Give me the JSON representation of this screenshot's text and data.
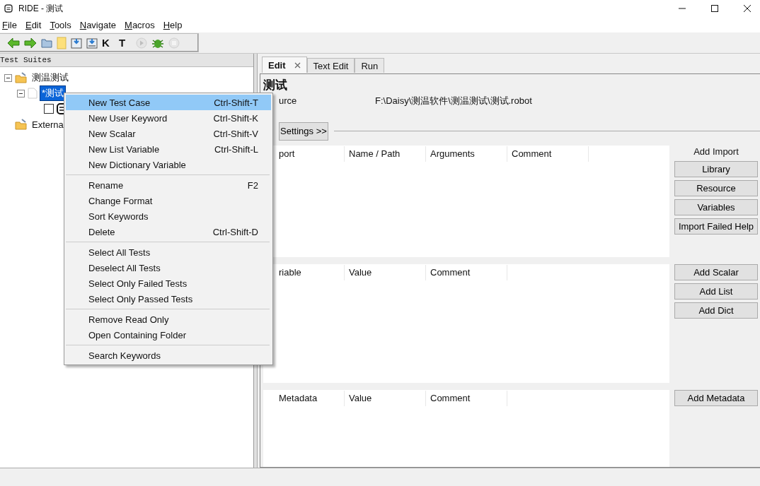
{
  "window": {
    "title": "RIDE - 测试"
  },
  "menubar": [
    "File",
    "Edit",
    "Tools",
    "Navigate",
    "Macros",
    "Help"
  ],
  "toolbar": [
    {
      "kind": "back",
      "disabled": false
    },
    {
      "kind": "forward",
      "disabled": false
    },
    {
      "kind": "open-suite",
      "disabled": false
    },
    {
      "kind": "open-dir",
      "disabled": false
    },
    {
      "kind": "save",
      "disabled": false
    },
    {
      "kind": "save-all",
      "disabled": false
    },
    {
      "kind": "search",
      "label": "K",
      "disabled": false
    },
    {
      "kind": "search",
      "label": "T",
      "disabled": false
    },
    {
      "kind": "run",
      "disabled": true
    },
    {
      "kind": "debug",
      "disabled": false
    },
    {
      "kind": "stop",
      "disabled": true
    }
  ],
  "tree": {
    "title": "Test Suites",
    "nodes": [
      {
        "label": "测温测试",
        "kind": "suite",
        "expanded": true,
        "selected": false,
        "children": [
          {
            "label": "*测试",
            "kind": "file",
            "expanded": true,
            "selected": true,
            "children": [
              {
                "kind": "test",
                "checked": false,
                "selected": false
              }
            ]
          }
        ]
      },
      {
        "label": "Externa",
        "kind": "suite",
        "selected": false
      }
    ]
  },
  "tabs": [
    {
      "label": "Edit",
      "selected": true,
      "closable": true
    },
    {
      "label": "Text Edit",
      "selected": false,
      "closable": false
    },
    {
      "label": "Run",
      "selected": false,
      "closable": false
    }
  ],
  "editor": {
    "title": "测试",
    "source_label": "urce",
    "source_value": "F:\\Daisy\\测温软件\\测温测试\\测试.robot",
    "settings_button": "Settings >>",
    "sections": [
      {
        "columns": [
          "port",
          "Name / Path",
          "Arguments",
          "Comment"
        ],
        "heading": "Add Import",
        "buttons": [
          "Library",
          "Resource",
          "Variables",
          "Import Failed Help"
        ]
      },
      {
        "columns": [
          "riable",
          "Value",
          "Comment"
        ],
        "buttons": [
          "Add Scalar",
          "Add List",
          "Add Dict"
        ]
      },
      {
        "columns": [
          "Metadata",
          "Value",
          "Comment"
        ],
        "buttons": [
          "Add Metadata"
        ]
      }
    ]
  },
  "context_menu": [
    [
      {
        "label": "New Test Case",
        "shortcut": "Ctrl-Shift-T",
        "selected": true
      },
      {
        "label": "New User Keyword",
        "shortcut": "Ctrl-Shift-K",
        "selected": false
      },
      {
        "label": "New Scalar",
        "shortcut": "Ctrl-Shift-V",
        "selected": false
      },
      {
        "label": "New List Variable",
        "shortcut": "Ctrl-Shift-L",
        "selected": false
      },
      {
        "label": "New Dictionary Variable",
        "selected": false
      }
    ],
    [
      {
        "label": "Rename",
        "shortcut": "F2",
        "selected": false
      },
      {
        "label": "Change Format",
        "selected": false
      },
      {
        "label": "Sort Keywords",
        "selected": false
      },
      {
        "label": "Delete",
        "shortcut": "Ctrl-Shift-D",
        "selected": false
      }
    ],
    [
      {
        "label": "Select All Tests",
        "selected": false
      },
      {
        "label": "Deselect All Tests",
        "selected": false
      },
      {
        "label": "Select Only Failed Tests",
        "selected": false
      },
      {
        "label": "Select Only Passed Tests",
        "selected": false
      }
    ],
    [
      {
        "label": "Remove Read Only",
        "selected": false
      },
      {
        "label": "Open Containing Folder",
        "selected": false
      }
    ],
    [
      {
        "label": "Search Keywords",
        "selected": false
      }
    ]
  ]
}
